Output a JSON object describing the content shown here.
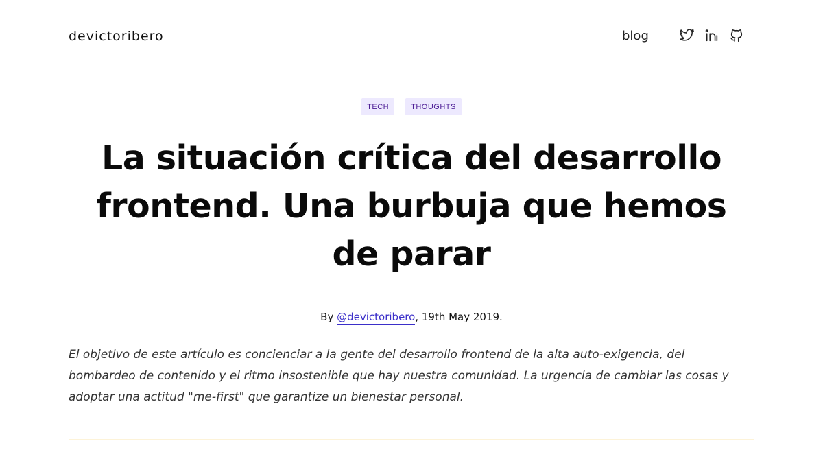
{
  "header": {
    "site_title": "devictoribero",
    "nav": {
      "blog_label": "blog"
    },
    "social": [
      {
        "icon": "twitter-icon"
      },
      {
        "icon": "linkedin-icon"
      },
      {
        "icon": "github-icon"
      }
    ]
  },
  "article": {
    "tags": [
      "TECH",
      "THOUGHTS"
    ],
    "title": "La situación crítica del desarrollo frontend. Una burbuja que hemos de parar",
    "byline": {
      "prefix": "By ",
      "author": "@devictoribero",
      "date": ", 19th May 2019."
    },
    "intro": "El objetivo de este artículo es concienciar a la gente del desarrollo frontend de la alta auto-exigencia, del bombardeo de contenido y el ritmo insostenible que hay nuestra comunidad. La urgencia de cambiar las cosas y adoptar una actitud \"me-first\" que garantize un bienestar personal."
  },
  "colors": {
    "accent": "#3b2fc9",
    "tag_bg": "#ede9fe",
    "tag_text": "#4c1d95",
    "divider": "#fdf3d8"
  }
}
